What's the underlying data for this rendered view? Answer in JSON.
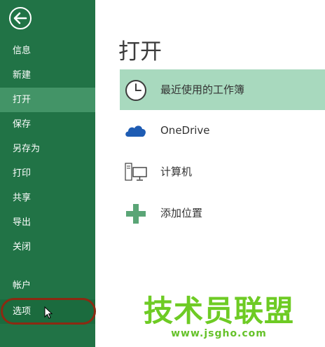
{
  "sidebar": {
    "back_icon": "back-arrow-icon",
    "items": [
      {
        "label": "信息"
      },
      {
        "label": "新建"
      },
      {
        "label": "打开",
        "active": true
      },
      {
        "label": "保存"
      },
      {
        "label": "另存为"
      },
      {
        "label": "打印"
      },
      {
        "label": "共享"
      },
      {
        "label": "导出"
      },
      {
        "label": "关闭"
      },
      {
        "label": "帐户"
      },
      {
        "label": "选项",
        "highlighted": true
      }
    ]
  },
  "main": {
    "title": "打开",
    "locations": [
      {
        "label": "最近使用的工作簿",
        "icon": "clock-icon",
        "active": true
      },
      {
        "label": "OneDrive",
        "icon": "cloud-icon"
      },
      {
        "label": "计算机",
        "icon": "computer-icon"
      },
      {
        "label": "添加位置",
        "icon": "plus-icon"
      }
    ]
  },
  "watermark": {
    "main": "技术员联盟",
    "url": "www.jsgho.com"
  },
  "colors": {
    "sidebar_bg": "#217346",
    "sidebar_active": "#439467",
    "location_active": "#a8d9be",
    "annotation_ring": "#8b2a12",
    "watermark": "#6ecb24"
  }
}
